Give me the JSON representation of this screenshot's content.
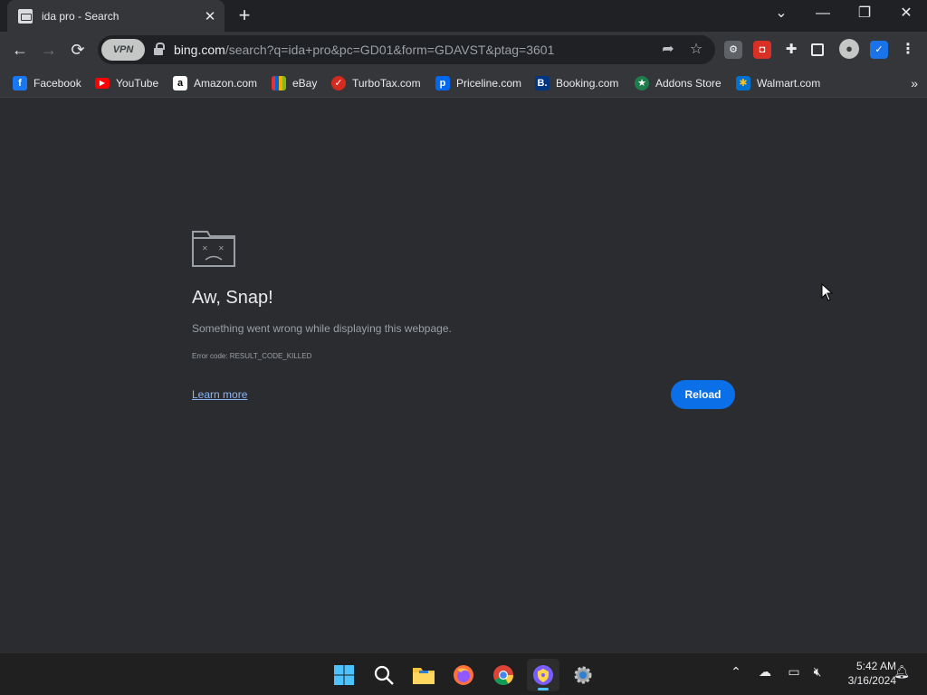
{
  "browser": {
    "tab_title": "ida pro - Search",
    "url_host": "bing.com",
    "url_path": "/search?q=ida+pro&pc=GD01&form=GDAVST&ptag=3601",
    "vpn_label": "VPN"
  },
  "bookmarks": [
    {
      "label": "Facebook",
      "icon": "facebook-icon",
      "color": "#1877f2"
    },
    {
      "label": "YouTube",
      "icon": "youtube-icon",
      "color": "#ff0000"
    },
    {
      "label": "Amazon.com",
      "icon": "amazon-icon",
      "color": "#ffffff"
    },
    {
      "label": "eBay",
      "icon": "ebay-icon",
      "color": "#e53238"
    },
    {
      "label": "TurboTax.com",
      "icon": "turbotax-icon",
      "color": "#d52b1e"
    },
    {
      "label": "Priceline.com",
      "icon": "priceline-icon",
      "color": "#0068ef"
    },
    {
      "label": "Booking.com",
      "icon": "booking-icon",
      "color": "#003580"
    },
    {
      "label": "Addons Store",
      "icon": "addons-store-icon",
      "color": "#1e7e4b"
    },
    {
      "label": "Walmart.com",
      "icon": "walmart-icon",
      "color": "#0071ce"
    }
  ],
  "error": {
    "title": "Aw, Snap!",
    "message": "Something went wrong while displaying this webpage.",
    "code": "Error code: RESULT_CODE_KILLED",
    "learn_more": "Learn more",
    "reload": "Reload"
  },
  "taskbar": {
    "time": "5:42 AM",
    "date": "3/16/2024"
  },
  "colors": {
    "accent": "#0b6fe8",
    "link": "#8ab4f8",
    "background": "#2b2c2f"
  }
}
